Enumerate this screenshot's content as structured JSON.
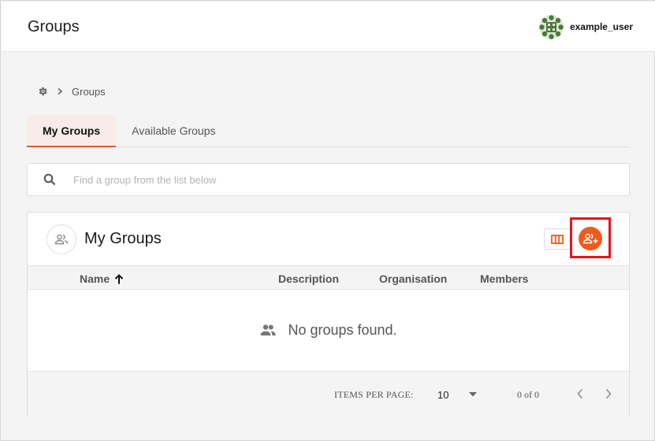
{
  "header": {
    "title": "Groups",
    "username": "example_user"
  },
  "breadcrumb": {
    "items": [
      "Groups"
    ]
  },
  "tabs": [
    {
      "label": "My Groups",
      "active": true
    },
    {
      "label": "Available Groups",
      "active": false
    }
  ],
  "search": {
    "placeholder": "Find a group from the list below",
    "value": ""
  },
  "card": {
    "title": "My Groups",
    "columns": [
      "Name",
      "Description",
      "Organisation",
      "Members"
    ],
    "sort_column": "Name",
    "sort_direction": "ascending",
    "empty_message": "No groups found."
  },
  "pagination": {
    "items_per_page_label": "ITEMS PER PAGE:",
    "items_per_page": "10",
    "range": "0 of 0"
  },
  "colors": {
    "accent": "#f05a1c",
    "tab_underline": "#e35b2a",
    "highlight_box": "#e8141c",
    "avatar_green": "#4a7a3a"
  },
  "icons": {
    "breadcrumb_home": "gear-icon",
    "breadcrumb_separator": "chevron-right-icon",
    "search": "search-icon",
    "card": "group-icon",
    "column_toggle": "view-column-icon",
    "add_group": "group-add-icon",
    "sort": "arrow-up-icon",
    "empty": "group-icon",
    "items_per_page": "caret-down-icon",
    "prev_page": "chevron-left-icon",
    "next_page": "chevron-right-icon"
  }
}
